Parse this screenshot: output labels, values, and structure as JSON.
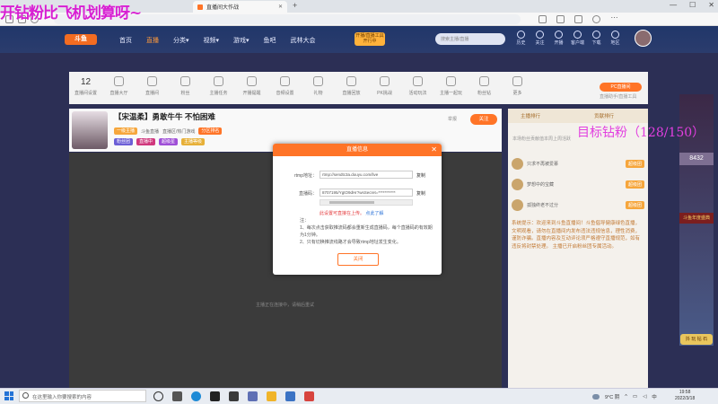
{
  "overlay": {
    "top_text": "开钻粉比飞机划算呀~",
    "fans_text": "目标钻粉（128/150）"
  },
  "browser": {
    "tab_title": "直播间大作战",
    "new_tab": "+",
    "controls": [
      "—",
      "☐",
      "✕"
    ]
  },
  "header": {
    "logo": "斗鱼",
    "nav": [
      "首页",
      "直播",
      "分类▾",
      "视频▾",
      "游戏▾",
      "鱼吧",
      "武林大会"
    ],
    "live_button": [
      "开播/直播工具",
      "开行中"
    ],
    "search_placeholder": "搜索主播/直播",
    "icons": [
      {
        "name": "history-icon",
        "label": "历史"
      },
      {
        "name": "follow-icon",
        "label": "关注"
      },
      {
        "name": "open-live-icon",
        "label": "开播"
      },
      {
        "name": "message-icon",
        "label": "客户端"
      },
      {
        "name": "download-icon",
        "label": "下载"
      },
      {
        "name": "location-icon",
        "label": "地区"
      }
    ]
  },
  "toolbar": {
    "first_number": "12",
    "first_label": "直播间设置",
    "items": [
      "直播大厅",
      "直播间",
      "粉丝",
      "主播任务",
      "开播提醒",
      "音频设置",
      "礼物",
      "直播回放",
      "PK挑战",
      "活动玩法",
      "主播一起玩",
      "粉丝钻",
      "更多"
    ],
    "pc_button": "PC直播间",
    "pc_sub": "直播助手/直播工具"
  },
  "room": {
    "title": "【宋温柔】勇敢牛牛  不怕困难",
    "report": "举报",
    "meta": "直播区/热门游戏",
    "sub_tags": [
      "一级主播",
      "斗鱼直播",
      "分区排名"
    ],
    "badges": [
      "粉丝团",
      "直播中",
      "超级星",
      "主播等级"
    ],
    "follow": "关注",
    "video_hint": "主播正在连接中，请稍后重试"
  },
  "right_panel": {
    "header_left": "主播排行",
    "header_right": "贡献排行",
    "note": "本场粉丝贡献值本周上周活跃",
    "rows": [
      {
        "name": "只求不再被爱慕",
        "btn": "超级团"
      },
      {
        "name": "梦想中的宝藏",
        "btn": "超级团"
      },
      {
        "name": "孤独终老不过分",
        "btn": "超级团"
      }
    ],
    "chat": "系统提示：欢迎来到斗鱼直播间！斗鱼倡导健康绿色直播，文明观看，请勿在直播间内发布违法违规信息，理性消费，谨防诈骗。直播内容及互动评论须严格遵守直播规范，如有违反将封禁处理。 主播已开启粉丝团专属活动。"
  },
  "side_banner": {
    "value1": "8432",
    "promo": "斗鱼年度盛典",
    "button": "抖 玩 钻 石"
  },
  "dialog": {
    "title": "直播信息",
    "rtmp_label": "rtmp地址：",
    "rtmp_value": "rtmp://sendtc3a.douyu.com/live",
    "key_label": "直播码：",
    "key_value": "8707195/YgtO9dHr?wsSecret=***********",
    "copy": "复制",
    "warn": "此设置可直接在上传。",
    "warn_link": "点此了解",
    "notes": [
      "注：",
      "1、每次点击获取推流码都会重新生成直播码，每个直播码的有效期为1分钟。",
      "2、只有切换推流线路才会导致rtmp地址发生变化。"
    ],
    "close_button": "关闭"
  },
  "taskbar": {
    "search_placeholder": "在这里输入你要搜索的内容",
    "weather": "9°C 阴",
    "time": "19:58",
    "date": "2022/3/18"
  }
}
